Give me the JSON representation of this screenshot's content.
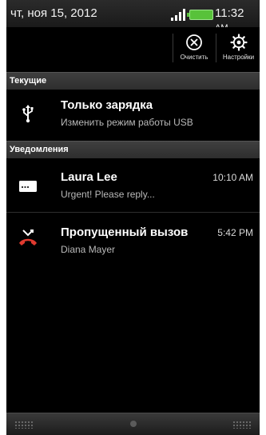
{
  "statusbar": {
    "date": "чт, ноя 15, 2012",
    "time": "11:32",
    "ampm": "AM"
  },
  "actions": {
    "clear_label": "Очистить",
    "settings_label": "Настройки"
  },
  "sections": {
    "current": "Текущие",
    "notifications": "Уведомления"
  },
  "ongoing": [
    {
      "title": "Только зарядка",
      "subtitle": "Изменить режим работы USB",
      "icon": "usb-icon"
    }
  ],
  "notifications": [
    {
      "title": "Laura Lee",
      "subtitle": "Urgent! Please reply...",
      "time": "10:10 AM",
      "icon": "message-icon"
    },
    {
      "title": "Пропущенный вызов",
      "subtitle": "Diana Mayer",
      "time": "5:42 PM",
      "icon": "missed-call-icon"
    }
  ],
  "colors": {
    "battery": "#58c23a",
    "missed_call": "#e03a2f",
    "background": "#000000"
  }
}
